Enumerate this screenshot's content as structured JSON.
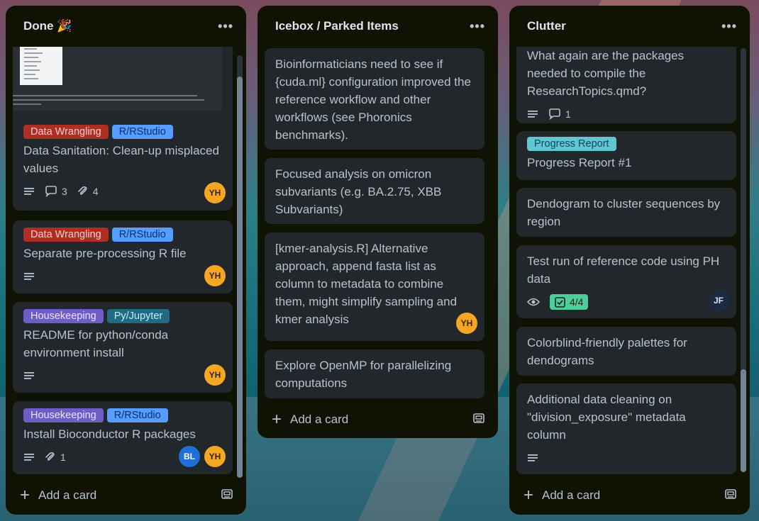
{
  "board": {
    "lists": [
      {
        "title": "Done 🎉",
        "add_card": "Add a card",
        "cards": [
          {
            "labels": [
              "Data Wrangling",
              "R/RStudio"
            ],
            "title": "Data Sanitation: Clean-up misplaced values",
            "comments": "3",
            "attachments": "4",
            "members": [
              "YH"
            ]
          },
          {
            "labels": [
              "Data Wrangling",
              "R/RStudio"
            ],
            "title": "Separate pre-processing R file",
            "members": [
              "YH"
            ]
          },
          {
            "labels": [
              "Housekeeping",
              "Py/Jupyter"
            ],
            "title": "README for python/conda environment install",
            "members": [
              "YH"
            ]
          },
          {
            "labels": [
              "Housekeeping",
              "R/RStudio"
            ],
            "title": "Install Bioconductor R packages",
            "attachments": "1",
            "members": [
              "BL",
              "YH"
            ]
          }
        ]
      },
      {
        "title": "Icebox / Parked Items",
        "add_card": "Add a card",
        "cards": [
          {
            "title": "Bioinformaticians need to see if {cuda.ml} configuration improved the reference workflow and other workflows (see Phoronics benchmarks)."
          },
          {
            "title": "Focused analysis on omicron subvariants (e.g. BA.2.75, XBB Subvariants)"
          },
          {
            "title": "[kmer-analysis.R] Alternative approach, append fasta list as column to metadata to combine them, might simplify sampling and kmer analysis",
            "members": [
              "YH"
            ]
          },
          {
            "title": "Explore OpenMP for parallelizing computations"
          }
        ]
      },
      {
        "title": "Clutter",
        "add_card": "Add a card",
        "cards": [
          {
            "title": "What again are the packages needed to compile the ResearchTopics.qmd?",
            "comments": "1"
          },
          {
            "labels": [
              "Progress Report"
            ],
            "title": "Progress Report #1"
          },
          {
            "title": "Dendogram to cluster sequences by region"
          },
          {
            "title": "Test run of reference code using PH data",
            "checklist": "4/4",
            "members": [
              "JF"
            ]
          },
          {
            "title": "Colorblind-friendly palettes for dendograms"
          },
          {
            "title": "Additional data cleaning on \"division_exposure\" metadata column"
          }
        ]
      }
    ]
  },
  "colors": {
    "list_bg": "#101204",
    "card_bg": "#22272b",
    "label_red": "#ae2e24",
    "label_blue": "#579dff",
    "label_purple": "#6e5dc6",
    "label_teal": "#206a83",
    "label_cyan": "#60c6d2",
    "checklist_done": "#4bce97",
    "avatar_yh": "#f5a623",
    "avatar_bl": "#1f6fd6",
    "avatar_jf": "#1c2b41"
  },
  "icons": [
    "description-icon",
    "comment-icon",
    "attachment-icon",
    "watch-icon",
    "checklist-icon",
    "plus-icon",
    "template-icon",
    "more-icon"
  ]
}
